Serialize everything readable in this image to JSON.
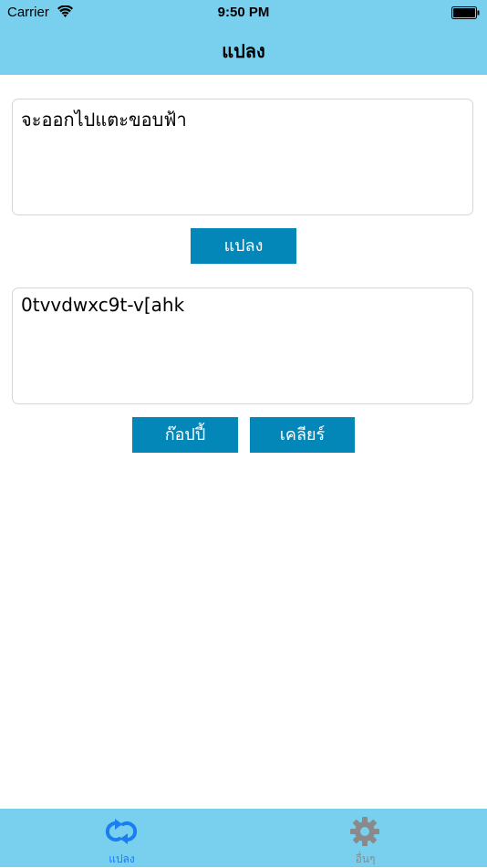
{
  "status_bar": {
    "carrier": "Carrier",
    "time": "9:50 PM"
  },
  "nav": {
    "title": "แปลง"
  },
  "input": {
    "value": "จะออกไปแตะขอบฟ้า"
  },
  "convert_button": {
    "label": "แปลง"
  },
  "output": {
    "value": "0tvvdwxc9t-v[ahk"
  },
  "copy_button": {
    "label": "ก๊อปปี้"
  },
  "clear_button": {
    "label": "เคลียร์"
  },
  "tab_bar": {
    "tabs": [
      {
        "label": "แปลง",
        "icon": "convert-icon",
        "selected": true
      },
      {
        "label": "อื่นๆ",
        "icon": "gear-icon",
        "selected": false
      }
    ]
  },
  "colors": {
    "bar_background": "#78cfee",
    "button": "#0386b8",
    "tab_active": "#1a7ef0",
    "tab_inactive": "#8a8a8a"
  }
}
